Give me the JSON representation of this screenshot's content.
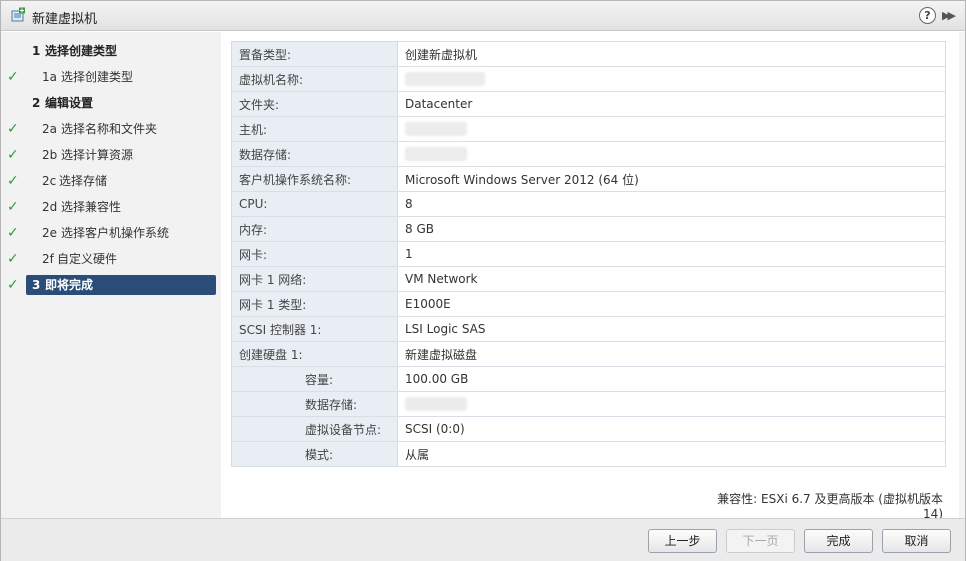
{
  "window": {
    "title": "新建虚拟机"
  },
  "titlebar": {
    "help_label": "?",
    "expand_label": "▶▶"
  },
  "nav": {
    "items": [
      {
        "num": "1",
        "label": "选择创建类型",
        "section": true,
        "checked": false
      },
      {
        "num": "1a",
        "label": "选择创建类型",
        "section": false,
        "checked": true
      },
      {
        "num": "2",
        "label": "编辑设置",
        "section": true,
        "checked": false
      },
      {
        "num": "2a",
        "label": "选择名称和文件夹",
        "section": false,
        "checked": true
      },
      {
        "num": "2b",
        "label": "选择计算资源",
        "section": false,
        "checked": true
      },
      {
        "num": "2c",
        "label": "选择存储",
        "section": false,
        "checked": true
      },
      {
        "num": "2d",
        "label": "选择兼容性",
        "section": false,
        "checked": true
      },
      {
        "num": "2e",
        "label": "选择客户机操作系统",
        "section": false,
        "checked": true
      },
      {
        "num": "2f",
        "label": "自定义硬件",
        "section": false,
        "checked": true
      },
      {
        "num": "3",
        "label": "即将完成",
        "section": true,
        "checked": true,
        "active": true
      }
    ]
  },
  "summary": {
    "rows": [
      {
        "key": "置备类型:",
        "value": "创建新虚拟机"
      },
      {
        "key": "虚拟机名称:",
        "value": ""
      },
      {
        "key": "文件夹:",
        "value": "Datacenter"
      },
      {
        "key": "主机:",
        "value": ""
      },
      {
        "key": "数据存储:",
        "value": ""
      },
      {
        "key": "客户机操作系统名称:",
        "value": "Microsoft Windows Server 2012 (64 位)"
      },
      {
        "key": "CPU:",
        "value": "8"
      },
      {
        "key": "内存:",
        "value": "8 GB"
      },
      {
        "key": "网卡:",
        "value": "1"
      },
      {
        "key": "网卡 1 网络:",
        "value": "VM Network"
      },
      {
        "key": "网卡 1 类型:",
        "value": "E1000E"
      },
      {
        "key": "SCSI 控制器 1:",
        "value": "LSI Logic SAS"
      },
      {
        "key": "创建硬盘 1:",
        "value": "新建虚拟磁盘"
      },
      {
        "key": "容量:",
        "value": "100.00 GB"
      },
      {
        "key": "数据存储:",
        "value": ""
      },
      {
        "key": "虚拟设备节点:",
        "value": "SCSI (0:0)"
      },
      {
        "key": "模式:",
        "value": "从属"
      }
    ],
    "compatibility": "兼容性: ESXi 6.7 及更高版本 (虚拟机版本 14)"
  },
  "footer": {
    "back_label": "上一步",
    "next_label": "下一页",
    "finish_label": "完成",
    "cancel_label": "取消"
  },
  "icons": {
    "title": "new-vm-icon",
    "check": "check-icon"
  },
  "colors": {
    "active_nav": "#2a4c78",
    "check": "#2e9b3a",
    "key_bg": "#e8eef4"
  }
}
